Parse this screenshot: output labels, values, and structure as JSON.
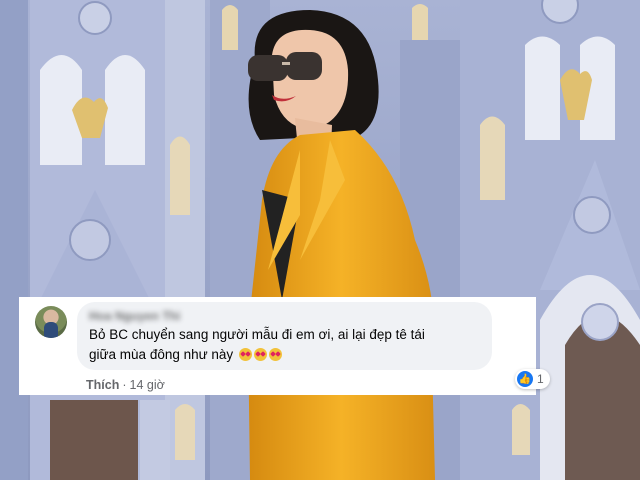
{
  "comment": {
    "author_name": "Hoa Nguyen Thi",
    "text_line1": "Bỏ BC chuyển sang người mẫu đi em ơi, ai lại đẹp tê tái",
    "text_line2": "giữa mùa đông như này",
    "reaction_count": "1",
    "like_action_label": "Thích",
    "separator": "·",
    "timestamp": "14 giờ",
    "reaction_icon": "like-icon",
    "emoji_icon": "heart-eyes-emoji-icon",
    "emoji_count": 3
  },
  "colors": {
    "church_facade": "#9aa6c8",
    "jacket": "#f2a81e",
    "like_blue": "#1877f2",
    "bubble": "#f0f2f5"
  }
}
